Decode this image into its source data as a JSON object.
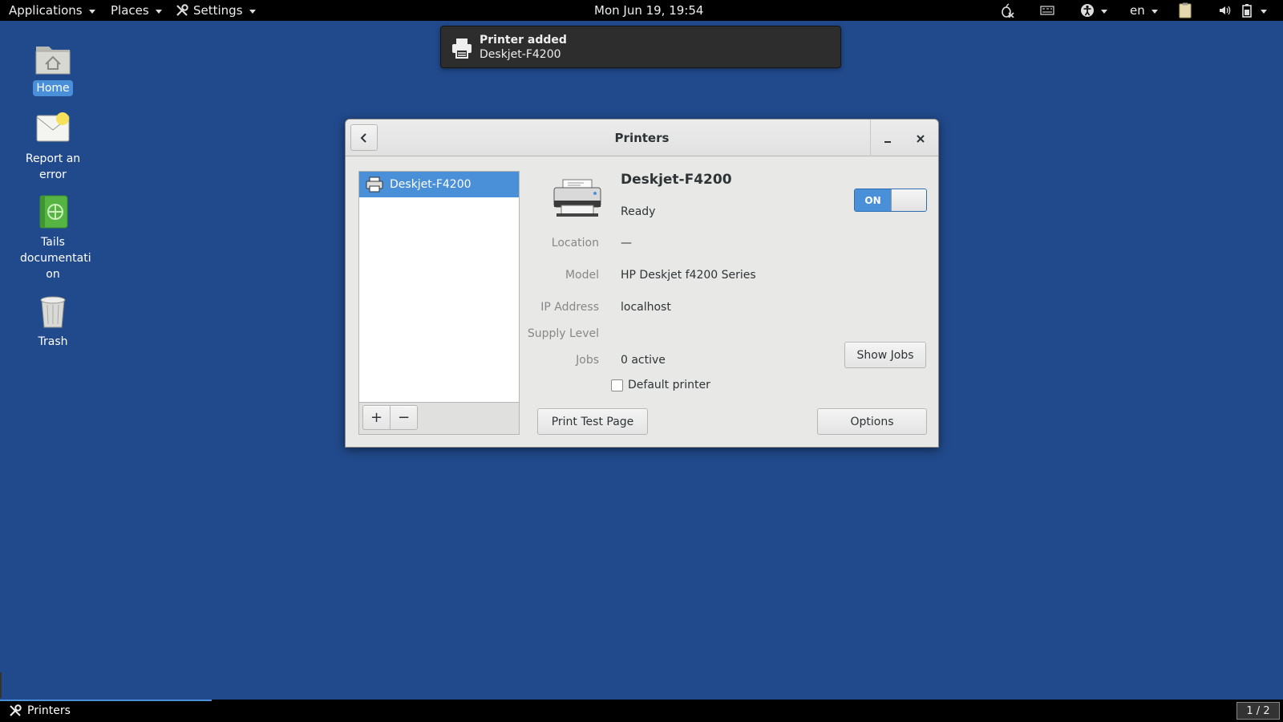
{
  "topbar": {
    "applications": "Applications",
    "places": "Places",
    "settings": "Settings",
    "clock": "Mon Jun 19, 19:54",
    "language": "en",
    "icons": [
      "tor-onion-icon",
      "network-icon",
      "accessibility-icon",
      "clipboard-icon",
      "volume-icon",
      "battery-icon"
    ]
  },
  "desktop": {
    "icons": [
      {
        "label": "Home",
        "icon": "home-folder-icon"
      },
      {
        "label": "Report an error",
        "icon": "whisperback-icon"
      },
      {
        "label": "Tails documentati on",
        "icon": "tails-documentation-icon"
      },
      {
        "label": "Trash",
        "icon": "trash-icon"
      }
    ]
  },
  "notification": {
    "title": "Printer added",
    "body": "Deskjet-F4200",
    "icon": "printer-icon"
  },
  "window": {
    "title": "Printers",
    "printer_list": [
      {
        "name": "Deskjet-F4200"
      }
    ],
    "add_label": "+",
    "remove_label": "−",
    "detail": {
      "name": "Deskjet-F4200",
      "status": "Ready",
      "toggle_label": "ON",
      "toggle_on": true,
      "labels": {
        "location": "Location",
        "model": "Model",
        "ip": "IP Address",
        "supply": "Supply Level",
        "jobs": "Jobs"
      },
      "values": {
        "location": "—",
        "model": "HP Deskjet f4200 Series",
        "ip": "localhost",
        "supply": "",
        "jobs": "0 active"
      },
      "show_jobs": "Show Jobs",
      "default_printer": "Default printer",
      "default_checked": false,
      "print_test": "Print Test Page",
      "options": "Options"
    }
  },
  "taskbar": {
    "task": "Printers",
    "pager": "1 / 2"
  },
  "colors": {
    "desktop": "#214a8c",
    "accent": "#4a90d9",
    "panel": "#000000"
  }
}
